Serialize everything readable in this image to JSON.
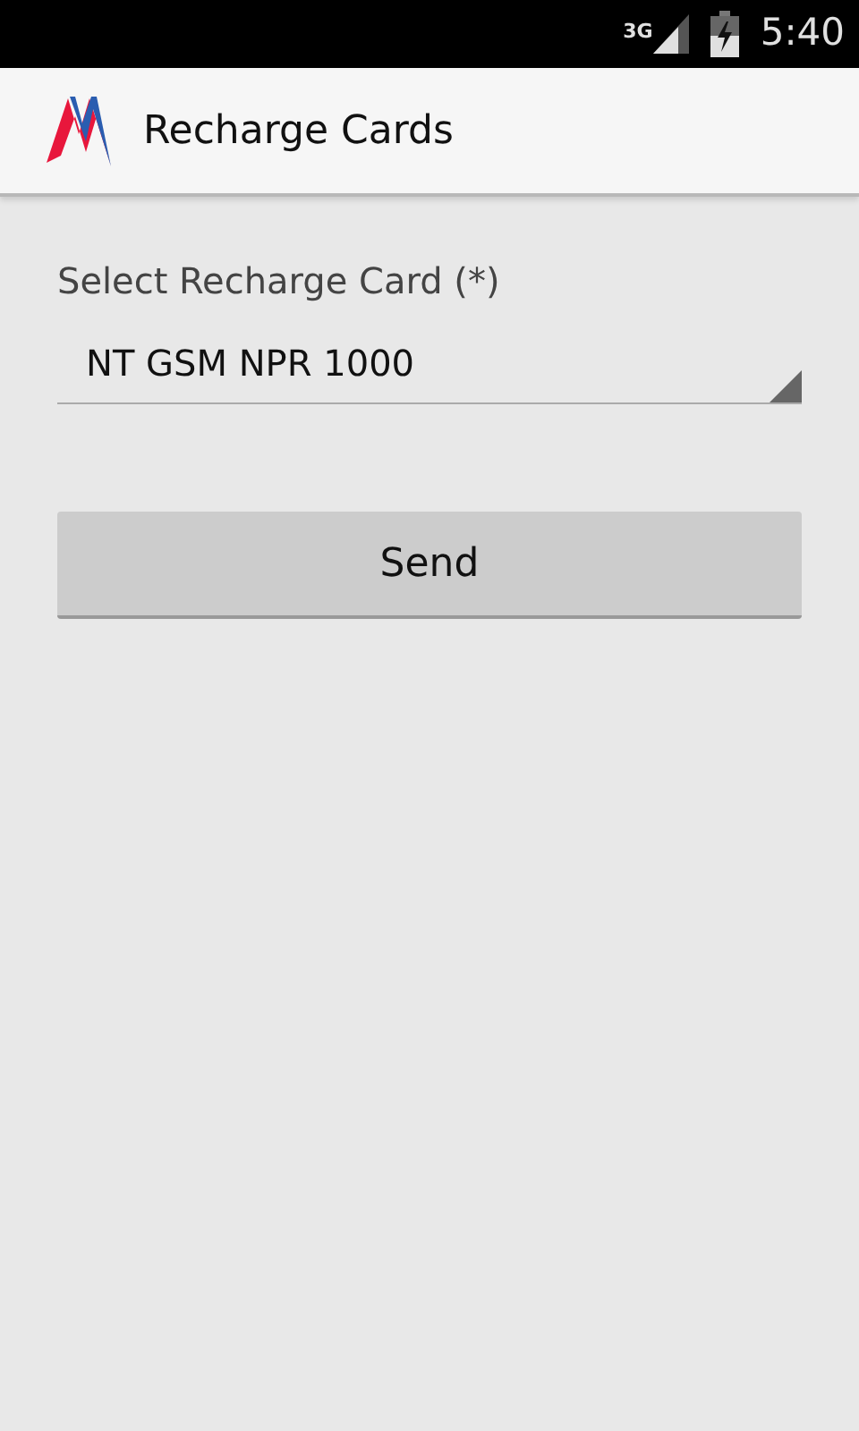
{
  "status_bar": {
    "network": "3G",
    "time": "5:40"
  },
  "action_bar": {
    "title": "Recharge Cards"
  },
  "form": {
    "label": "Select Recharge Card (*)",
    "spinner": {
      "value": "NT GSM NPR 1000"
    },
    "button": "Send"
  }
}
